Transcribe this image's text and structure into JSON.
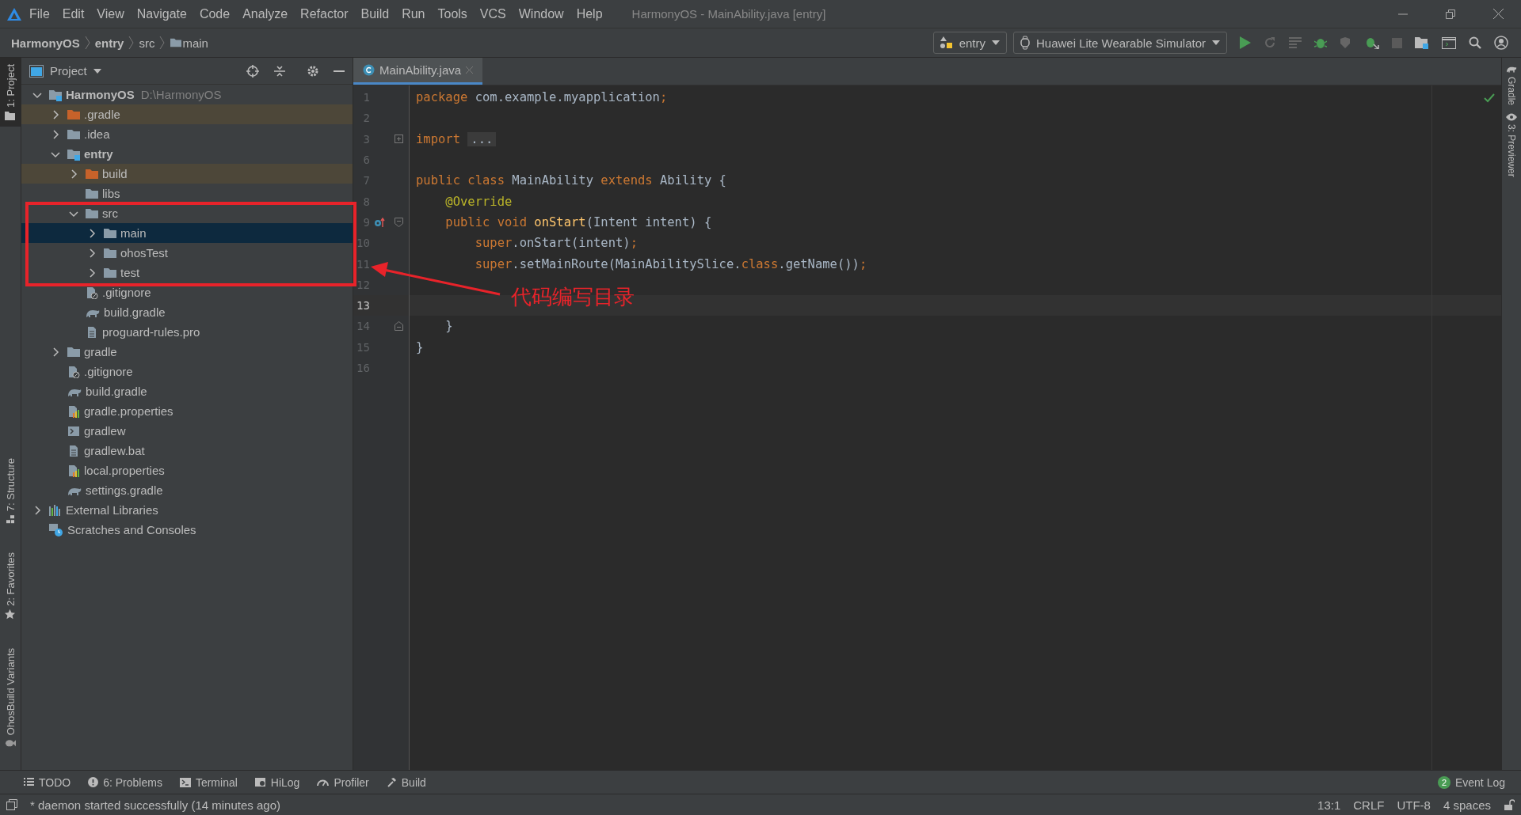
{
  "window": {
    "title": "HarmonyOS - MainAbility.java [entry]"
  },
  "menu": [
    "File",
    "Edit",
    "View",
    "Navigate",
    "Code",
    "Analyze",
    "Refactor",
    "Build",
    "Run",
    "Tools",
    "VCS",
    "Window",
    "Help"
  ],
  "breadcrumb": [
    {
      "label": "HarmonyOS",
      "kind": "project"
    },
    {
      "label": "entry",
      "kind": "module"
    },
    {
      "label": "src",
      "kind": "plain"
    },
    {
      "label": "main",
      "kind": "folder"
    }
  ],
  "toolbar": {
    "module_select": "entry",
    "device_select": "Huawei Lite Wearable Simulator"
  },
  "left_strip": [
    {
      "label": "1: Project",
      "selected": true,
      "kind": "project"
    },
    {
      "label": "7: Structure",
      "selected": false,
      "kind": "structure"
    },
    {
      "label": "2: Favorites",
      "selected": false,
      "kind": "favorites"
    },
    {
      "label": "OhosBuild Variants",
      "selected": false,
      "kind": "variants"
    }
  ],
  "right_strip": [
    {
      "label": "Gradle",
      "kind": "gradle"
    },
    {
      "label": "3: Previewer",
      "kind": "previewer"
    }
  ],
  "project_panel": {
    "title": "Project",
    "tree": [
      {
        "label": "HarmonyOS",
        "hint": "D:\\HarmonyOS",
        "kind": "module",
        "expanded": true,
        "selected": false,
        "children": [
          {
            "label": ".gradle",
            "kind": "excluded",
            "expanded": false,
            "selected": false
          },
          {
            "label": ".idea",
            "kind": "folder",
            "expanded": false,
            "selected": false
          },
          {
            "label": "entry",
            "kind": "module",
            "expanded": true,
            "selected": false,
            "children": [
              {
                "label": "build",
                "kind": "excluded",
                "expanded": false,
                "selected": false
              },
              {
                "label": "libs",
                "kind": "folder",
                "selected": false
              },
              {
                "label": "src",
                "kind": "folder",
                "expanded": true,
                "selected": false,
                "children": [
                  {
                    "label": "main",
                    "kind": "folder",
                    "expanded": false,
                    "selected": true
                  },
                  {
                    "label": "ohosTest",
                    "kind": "folder",
                    "expanded": false,
                    "selected": false
                  },
                  {
                    "label": "test",
                    "kind": "folder",
                    "expanded": false,
                    "selected": false
                  }
                ]
              },
              {
                "label": ".gitignore",
                "kind": "ignore",
                "selected": false
              },
              {
                "label": "build.gradle",
                "kind": "gradle",
                "selected": false
              },
              {
                "label": "proguard-rules.pro",
                "kind": "text",
                "selected": false
              }
            ]
          },
          {
            "label": "gradle",
            "kind": "folder",
            "expanded": false,
            "selected": false
          },
          {
            "label": ".gitignore",
            "kind": "ignore",
            "selected": false
          },
          {
            "label": "build.gradle",
            "kind": "gradle",
            "selected": false
          },
          {
            "label": "gradle.properties",
            "kind": "properties",
            "selected": false
          },
          {
            "label": "gradlew",
            "kind": "script",
            "selected": false
          },
          {
            "label": "gradlew.bat",
            "kind": "text",
            "selected": false
          },
          {
            "label": "local.properties",
            "kind": "properties",
            "selected": false
          },
          {
            "label": "settings.gradle",
            "kind": "gradle",
            "selected": false
          }
        ]
      },
      {
        "label": "External Libraries",
        "kind": "libraries",
        "expanded": false,
        "selected": false
      },
      {
        "label": "Scratches and Consoles",
        "kind": "scratches",
        "selected": false
      }
    ]
  },
  "editor": {
    "tab": {
      "label": "MainAbility.java",
      "selected": true
    },
    "lines": [
      {
        "number": "1",
        "current": false,
        "kind": "plain",
        "tokens": [
          {
            "kind": "kw",
            "text": "package "
          },
          {
            "kind": "plain",
            "text": "com.example.myapplication"
          },
          {
            "kind": "kw",
            "text": ";"
          }
        ]
      },
      {
        "number": "2",
        "current": false,
        "kind": "plain"
      },
      {
        "number": "3",
        "current": false,
        "kind": "fold-collapsed",
        "tokens": [
          {
            "kind": "kw",
            "text": "import "
          },
          {
            "kind": "folded",
            "text": "..."
          }
        ]
      },
      {
        "number": "6",
        "current": false,
        "kind": "plain"
      },
      {
        "number": "7",
        "current": false,
        "kind": "plain",
        "tokens": [
          {
            "kind": "kw",
            "text": "public class "
          },
          {
            "kind": "plain",
            "text": "MainAbility "
          },
          {
            "kind": "kw",
            "text": "extends "
          },
          {
            "kind": "plain",
            "text": "Ability {"
          }
        ]
      },
      {
        "number": "8",
        "current": false,
        "kind": "plain",
        "tokens": [
          {
            "kind": "annotation",
            "text": "    @Override"
          }
        ]
      },
      {
        "number": "9",
        "current": false,
        "override": true,
        "kind": "fold-start",
        "tokens": [
          {
            "kind": "kw",
            "text": "    public void "
          },
          {
            "kind": "method",
            "text": "onStart"
          },
          {
            "kind": "plain",
            "text": "(Intent intent) {"
          }
        ]
      },
      {
        "number": "10",
        "current": false,
        "kind": "plain",
        "tokens": [
          {
            "kind": "kw",
            "text": "        super"
          },
          {
            "kind": "plain",
            "text": ".onStart(intent)"
          },
          {
            "kind": "kw",
            "text": ";"
          }
        ]
      },
      {
        "number": "11",
        "current": false,
        "kind": "plain",
        "tokens": [
          {
            "kind": "kw",
            "text": "        super"
          },
          {
            "kind": "plain",
            "text": ".setMainRoute(MainAbilitySlice."
          },
          {
            "kind": "kw",
            "text": "class"
          },
          {
            "kind": "plain",
            "text": ".getName())"
          },
          {
            "kind": "kw",
            "text": ";"
          }
        ]
      },
      {
        "number": "12",
        "current": false,
        "kind": "plain"
      },
      {
        "number": "13",
        "current": true,
        "kind": "plain"
      },
      {
        "number": "14",
        "current": false,
        "kind": "fold-end",
        "tokens": [
          {
            "kind": "plain",
            "text": "    }"
          }
        ]
      },
      {
        "number": "15",
        "current": false,
        "kind": "plain",
        "tokens": [
          {
            "kind": "plain",
            "text": "}"
          }
        ]
      },
      {
        "number": "16",
        "current": false,
        "kind": "plain"
      }
    ]
  },
  "annotation": {
    "label": "代码编写目录"
  },
  "tool_tabs": [
    {
      "label": "TODO",
      "kind": "todo"
    },
    {
      "label": "6: Problems",
      "kind": "problems"
    },
    {
      "label": "Terminal",
      "kind": "terminal"
    },
    {
      "label": "HiLog",
      "kind": "hilog"
    },
    {
      "label": "Profiler",
      "kind": "profiler"
    },
    {
      "label": "Build",
      "kind": "build"
    }
  ],
  "event_log": {
    "label": "Event Log",
    "count": "2"
  },
  "status_bar": {
    "message": "* daemon started successfully (14 minutes ago)",
    "items": [
      "13:1",
      "CRLF",
      "UTF-8",
      "4 spaces"
    ]
  }
}
